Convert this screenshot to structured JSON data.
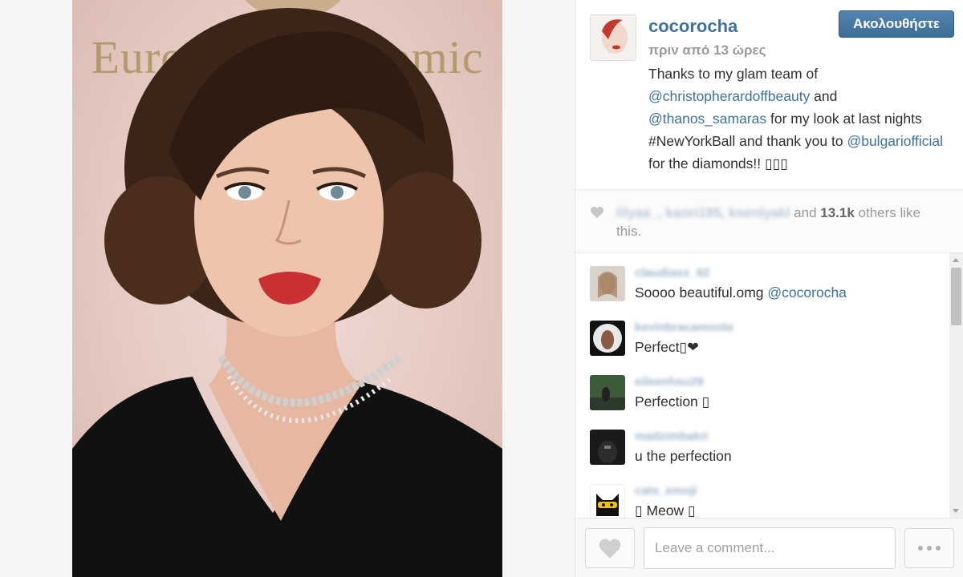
{
  "photo": {
    "backdrop_text": "European Economic",
    "subject": "portrait-photo"
  },
  "post": {
    "username": "cocorocha",
    "time": "πριν από 13 ώρες",
    "follow_label": "Ακολουθήστε",
    "caption": {
      "p1": "Thanks to my glam team of",
      "m1": "@christopherardoffbeauty",
      "p2": " and",
      "m2": "@thanos_samaras",
      "p3": " for my look at last nights #NewYorkBall and thank you to",
      "m3": "@bulgariofficial",
      "p4": " for the diamonds!! ▯▯▯"
    }
  },
  "likes": {
    "blurred_names": "lilyaa_, kaori195, ksenlyakl",
    "and": " and ",
    "count": "13.1k",
    "rest": " others like this."
  },
  "comments": [
    {
      "username": "claudiaxx_92",
      "text": "Soooo beautiful.omg ",
      "mention": "@cocorocha"
    },
    {
      "username": "kevinbracamonte",
      "text": "Perfect▯❤",
      "mention": ""
    },
    {
      "username": "eileenhsu29",
      "text": "Perfection ▯",
      "mention": ""
    },
    {
      "username": "madzimbakri",
      "text": "u the perfection",
      "mention": ""
    },
    {
      "username": "cats_emoji",
      "text": "▯ Meow ▯",
      "mention": ""
    }
  ],
  "footer": {
    "comment_placeholder": "Leave a comment..."
  },
  "colors": {
    "accent": "#3f729b",
    "follow_button": "#4a7aa6"
  }
}
